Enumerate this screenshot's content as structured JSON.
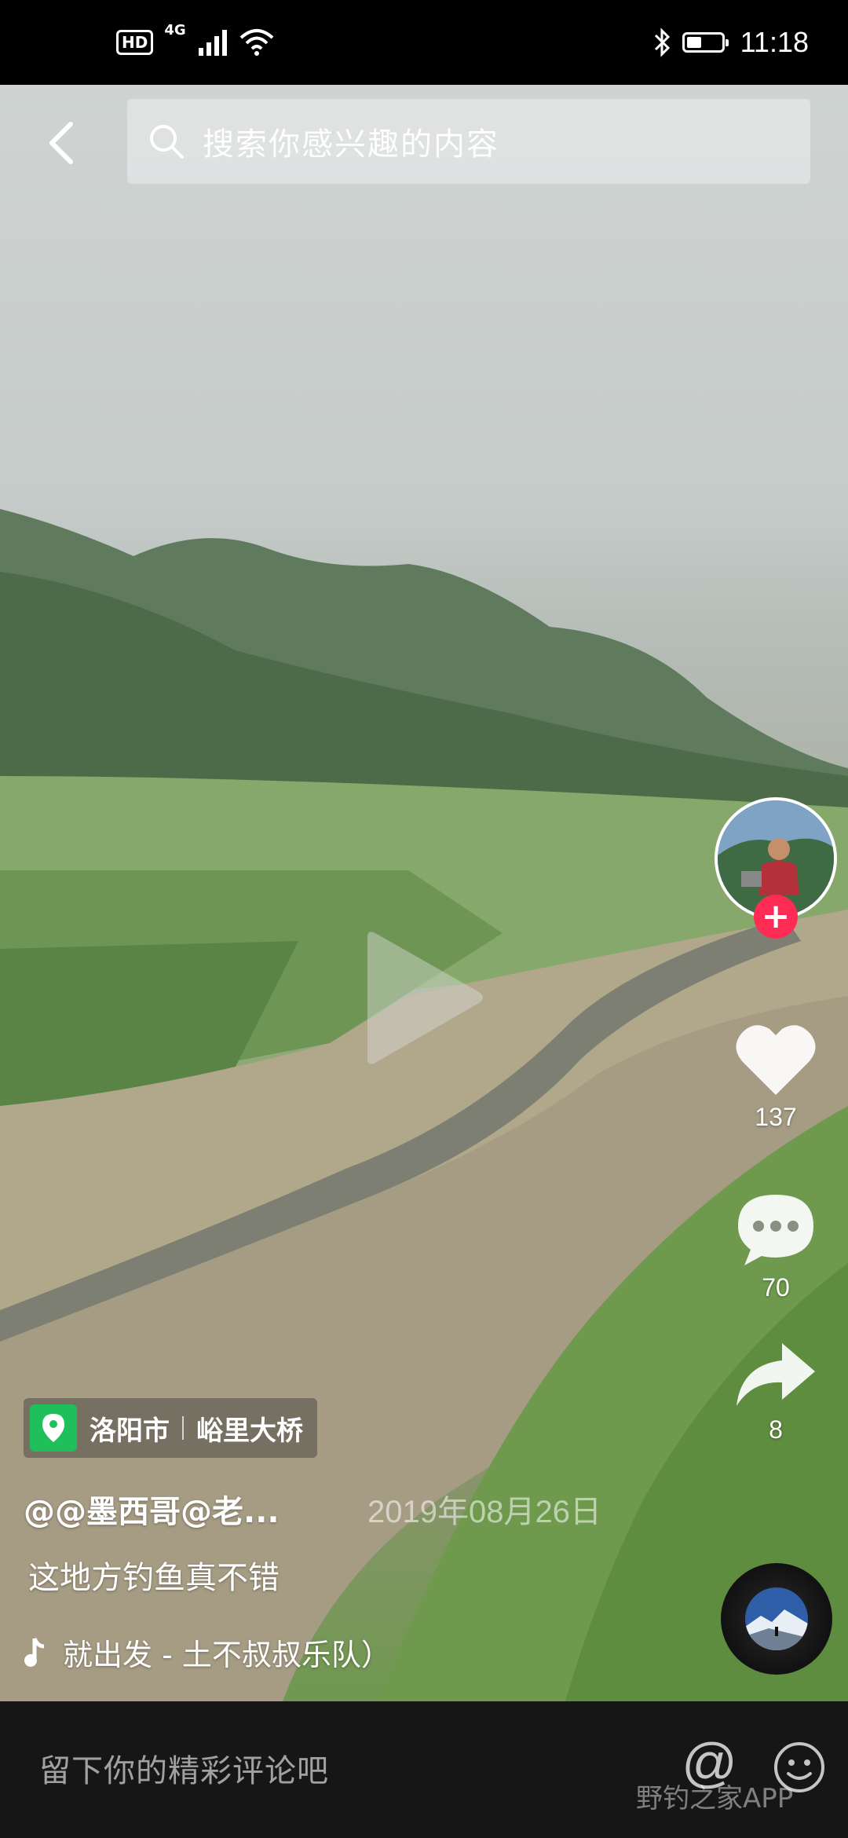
{
  "status_bar": {
    "hd_badge": "HD",
    "network": "4G",
    "time": "11:18",
    "battery_level": 0.45
  },
  "search": {
    "placeholder": "搜索你感兴趣的内容"
  },
  "sidebar": {
    "likes": "137",
    "comments": "70",
    "shares": "8"
  },
  "post": {
    "location_city": "洛阳市",
    "location_place": "峪里大桥",
    "author": "@@墨西哥@老...",
    "date": "2019年08月26日",
    "caption": "这地方钓鱼真不错",
    "music": "就出发 - 土不叔叔乐队）"
  },
  "comment_bar": {
    "placeholder": "留下你的精彩评论吧",
    "at_symbol": "@",
    "watermark": "野钓之家APP"
  },
  "colors": {
    "follow_red": "#fe2c55",
    "location_green": "#1fc05b",
    "comment_bar_bg": "#161616"
  }
}
